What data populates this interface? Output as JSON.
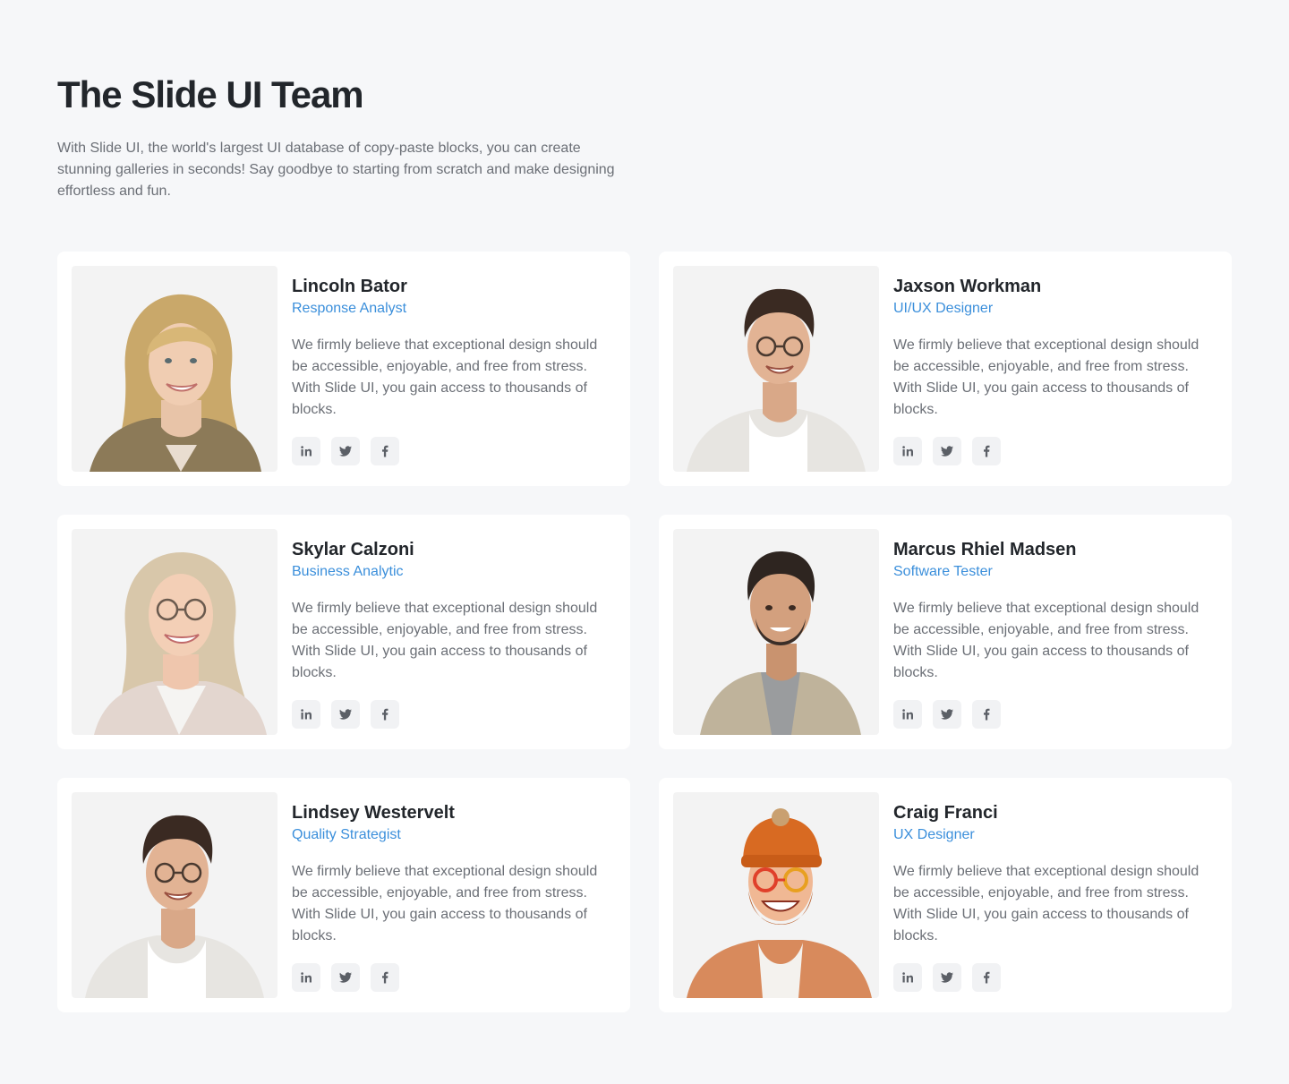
{
  "header": {
    "title": "The Slide UI Team",
    "subtitle": "With Slide UI, the world's largest UI database of copy-paste blocks, you can create stunning galleries in seconds! Say goodbye to starting from scratch and make designing effortless and fun."
  },
  "members": [
    {
      "name": "Lincoln Bator",
      "role": "Response Analyst",
      "bio": "We firmly believe that exceptional design should be accessible, enjoyable, and free from stress. With Slide UI, you gain access to thousands of blocks.",
      "photo": "woman-blonde-portrait"
    },
    {
      "name": "Jaxson Workman",
      "role": "UI/UX Designer",
      "bio": "We firmly believe that exceptional design should be accessible, enjoyable, and free from stress. With Slide UI, you gain access to thousands of blocks.",
      "photo": "man-glasses-portrait"
    },
    {
      "name": "Skylar Calzoni",
      "role": "Business Analytic",
      "bio": "We firmly believe that exceptional design should be accessible, enjoyable, and free from stress. With Slide UI, you gain access to thousands of blocks.",
      "photo": "woman-glasses-portrait"
    },
    {
      "name": "Marcus Rhiel Madsen",
      "role": "Software Tester",
      "bio": "We firmly believe that exceptional design should be accessible, enjoyable, and free from stress. With Slide UI, you gain access to thousands of blocks.",
      "photo": "man-jacket-portrait"
    },
    {
      "name": "Lindsey Westervelt",
      "role": "Quality Strategist",
      "bio": "We firmly believe that exceptional design should be accessible, enjoyable, and free from stress. With Slide UI, you gain access to thousands of blocks.",
      "photo": "man-glasses-portrait"
    },
    {
      "name": "Craig Franci",
      "role": "UX Designer",
      "bio": "We firmly believe that exceptional design should be accessible, enjoyable, and free from stress. With Slide UI, you gain access to thousands of blocks.",
      "photo": "man-beanie-portrait"
    }
  ],
  "social_icons": [
    "linkedin-icon",
    "twitter-icon",
    "facebook-icon"
  ],
  "colors": {
    "background": "#f6f7f9",
    "card": "#ffffff",
    "accent": "#3b8fdb",
    "text": "#22262b",
    "muted": "#6b6f76"
  }
}
